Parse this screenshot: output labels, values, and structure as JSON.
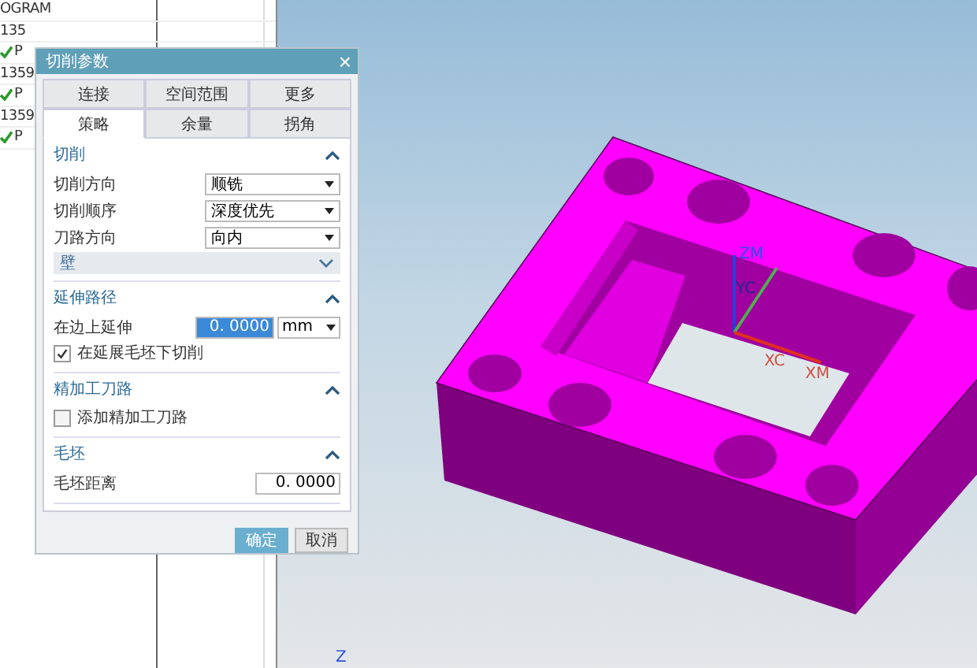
{
  "navigator": {
    "rows": [
      {
        "text": "OGRAM",
        "checked": false
      },
      {
        "text": "135",
        "checked": false
      },
      {
        "text": "P",
        "checked": true
      },
      {
        "text": "1359",
        "checked": false
      },
      {
        "text": "P",
        "checked": true
      },
      {
        "text": "1359",
        "checked": false
      },
      {
        "text": "P",
        "checked": true
      }
    ]
  },
  "dialog": {
    "title": "切削参数",
    "close": "×",
    "tabs_top": [
      {
        "label": "连接",
        "selected": false
      },
      {
        "label": "空间范围",
        "selected": false
      },
      {
        "label": "更多",
        "selected": false
      }
    ],
    "tabs_bottom": [
      {
        "label": "策略",
        "selected": true
      },
      {
        "label": "余量",
        "selected": false
      },
      {
        "label": "拐角",
        "selected": false
      }
    ],
    "sections": [
      {
        "title": "切削",
        "expanded": true,
        "rows": [
          {
            "kind": "select",
            "label": "切削方向",
            "value": "顺铣"
          },
          {
            "kind": "select",
            "label": "切削顺序",
            "value": "深度优先"
          },
          {
            "kind": "select",
            "label": "刀路方向",
            "value": "向内"
          },
          {
            "kind": "group",
            "label": "壁",
            "expanded": false
          }
        ]
      },
      {
        "title": "延伸路径",
        "expanded": true,
        "rows": [
          {
            "kind": "number_unit",
            "label": "在边上延伸",
            "value": "0. 0000",
            "unit": "mm"
          },
          {
            "kind": "check",
            "label": "在延展毛坯下切削",
            "checked": true
          }
        ]
      },
      {
        "title": "精加工刀路",
        "expanded": true,
        "rows": [
          {
            "kind": "check",
            "label": "添加精加工刀路",
            "checked": false
          }
        ]
      },
      {
        "title": "毛坯",
        "expanded": true,
        "rows": [
          {
            "kind": "number",
            "label": "毛坯距离",
            "value": "0. 0000"
          }
        ]
      }
    ],
    "buttons": [
      {
        "label": "确定",
        "selected": true
      },
      {
        "label": "取消",
        "selected": false
      }
    ]
  },
  "viewport": {
    "axis_labels": [
      "ZM",
      "YC",
      "XC",
      "XM"
    ],
    "corner_axis": "Z"
  }
}
